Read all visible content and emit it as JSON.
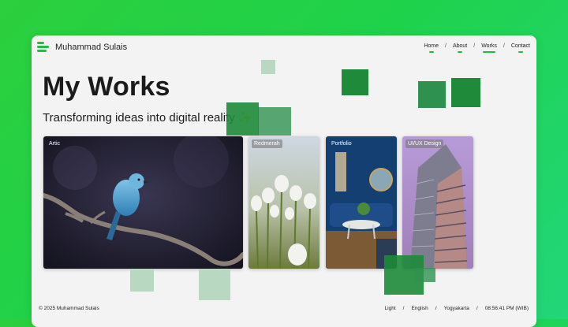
{
  "brand": {
    "name": "Muhammad Sulais"
  },
  "nav": {
    "home": "Home",
    "about": "About",
    "works": "Works",
    "contact": "Contact",
    "separator": "/",
    "active": "Works"
  },
  "hero": {
    "title": "My Works",
    "subtitle": "Transforming ideas into digital reality",
    "subtitle_emoji": "✨"
  },
  "works": [
    {
      "label": "Artic",
      "image": "blue bird on branch"
    },
    {
      "label": "Redmerah",
      "image": "white tulips"
    },
    {
      "label": "Portfolio",
      "image": "blue interior room"
    },
    {
      "label": "UI/UX Design",
      "image": "skyscraper"
    }
  ],
  "footer": {
    "copyright": "© 2025 Muhammad Sulais",
    "theme": "Light",
    "language": "English",
    "location": "Yogyakarta",
    "time": "08:56:41 PM (WIB)",
    "separator": "/"
  },
  "colors": {
    "accent": "#1fbf3e",
    "background_gradient": [
      "#2ccf3d",
      "#22d67a"
    ],
    "square_dark": "#1e8a3a",
    "square_light": "#b9d8c2"
  }
}
